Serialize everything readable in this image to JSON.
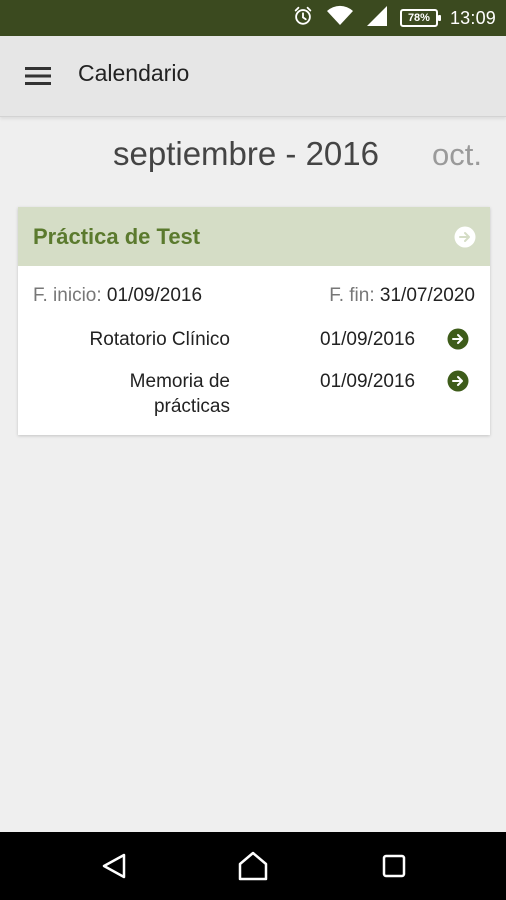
{
  "status_bar": {
    "time": "13:09",
    "battery": "78%",
    "icons": [
      "alarm-icon",
      "wifi-icon",
      "signal-icon",
      "battery-icon"
    ]
  },
  "app_bar": {
    "title": "Calendario",
    "menu_icon": "menu-icon"
  },
  "month_header": {
    "current": "septiembre - 2016",
    "next": "oct."
  },
  "card": {
    "title": "Práctica de Test",
    "start_label": "F. inicio:",
    "start_value": "01/09/2016",
    "end_label": "F. fin:",
    "end_value": "31/07/2020",
    "activities": [
      {
        "name_line1": "Rotatorio Clínico",
        "name_line2": "",
        "date": "01/09/2016"
      },
      {
        "name_line1": "Memoria de",
        "name_line2": "prácticas",
        "date": "01/09/2016"
      }
    ]
  },
  "colors": {
    "status_bar": "#3b4a1f",
    "accent_green": "#5b7a2e",
    "card_header": "#d5ddc6",
    "background": "#efefef"
  },
  "nav_bar": {
    "icons": [
      "back-icon",
      "home-icon",
      "recents-icon"
    ]
  }
}
